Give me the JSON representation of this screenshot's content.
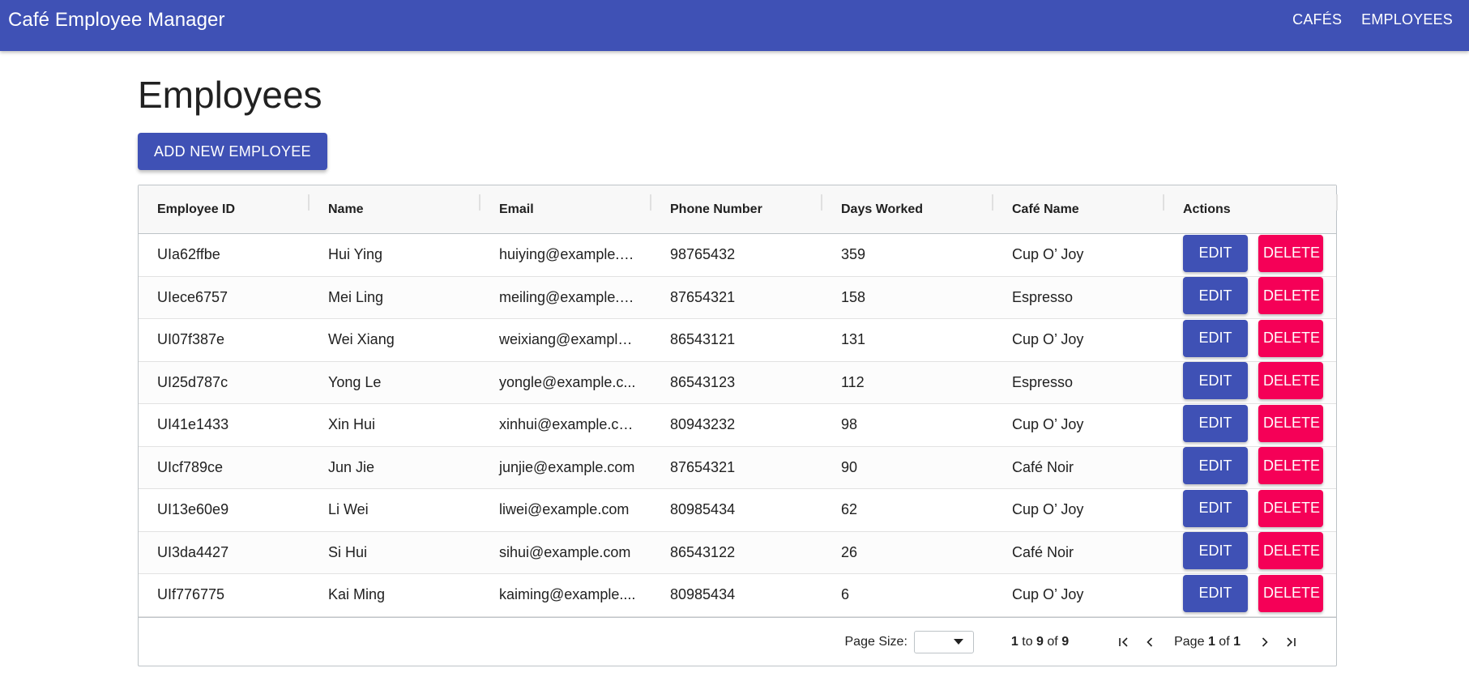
{
  "app": {
    "title": "Café Employee Manager",
    "nav": [
      "CAFÉS",
      "EMPLOYEES"
    ]
  },
  "page": {
    "heading": "Employees",
    "add_button_label": "ADD NEW EMPLOYEE"
  },
  "colors": {
    "primary": "#3f51b5",
    "delete": "#f50057"
  },
  "table": {
    "columns": [
      "Employee ID",
      "Name",
      "Email",
      "Phone Number",
      "Days Worked",
      "Café Name",
      "Actions"
    ],
    "edit_label": "EDIT",
    "delete_label": "DELETE",
    "rows": [
      {
        "id": "UIa62ffbe",
        "name": "Hui Ying",
        "email": "huiying@example.c...",
        "phone": "98765432",
        "days": "359",
        "cafe": "Cup O’ Joy"
      },
      {
        "id": "UIece6757",
        "name": "Mei Ling",
        "email": "meiling@example.c...",
        "phone": "87654321",
        "days": "158",
        "cafe": "Espresso"
      },
      {
        "id": "UI07f387e",
        "name": "Wei Xiang",
        "email": "weixiang@example....",
        "phone": "86543121",
        "days": "131",
        "cafe": "Cup O’ Joy"
      },
      {
        "id": "UI25d787c",
        "name": "Yong Le",
        "email": "yongle@example.c...",
        "phone": "86543123",
        "days": "112",
        "cafe": "Espresso"
      },
      {
        "id": "UI41e1433",
        "name": "Xin Hui",
        "email": "xinhui@example.com",
        "phone": "80943232",
        "days": "98",
        "cafe": "Cup O’ Joy"
      },
      {
        "id": "UIcf789ce",
        "name": "Jun Jie",
        "email": "junjie@example.com",
        "phone": "87654321",
        "days": "90",
        "cafe": "Café Noir"
      },
      {
        "id": "UI13e60e9",
        "name": "Li Wei",
        "email": "liwei@example.com",
        "phone": "80985434",
        "days": "62",
        "cafe": "Cup O’ Joy"
      },
      {
        "id": "UI3da4427",
        "name": "Si Hui",
        "email": "sihui@example.com",
        "phone": "86543122",
        "days": "26",
        "cafe": "Café Noir"
      },
      {
        "id": "UIf776775",
        "name": "Kai Ming",
        "email": "kaiming@example....",
        "phone": "80985434",
        "days": "6",
        "cafe": "Cup O’ Joy"
      }
    ]
  },
  "footer": {
    "page_size_label": "Page Size:",
    "range_from": "1",
    "range_to_word": "to",
    "range_to": "9",
    "range_of_word": "of",
    "range_total": "9",
    "page_word": "Page",
    "page_current": "1",
    "page_of_word": "of",
    "page_total": "1",
    "icons": [
      "first-page-icon",
      "previous-page-icon",
      "next-page-icon",
      "last-page-icon"
    ]
  }
}
